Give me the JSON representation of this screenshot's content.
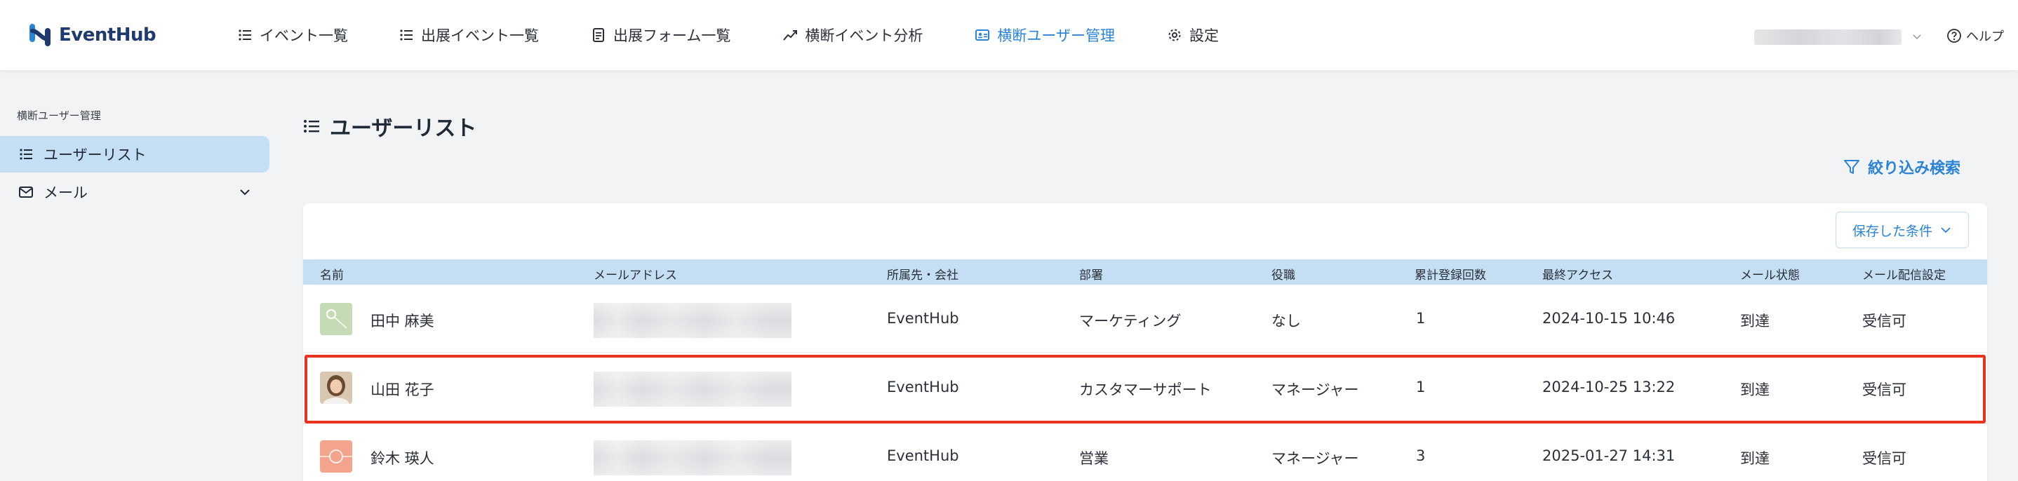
{
  "app": {
    "logo_text": "EventHub"
  },
  "nav": {
    "items": [
      {
        "label": "イベント一覧",
        "icon": "list-icon",
        "active": false
      },
      {
        "label": "出展イベント一覧",
        "icon": "list-icon",
        "active": false
      },
      {
        "label": "出展フォーム一覧",
        "icon": "form-icon",
        "active": false
      },
      {
        "label": "横断イベント分析",
        "icon": "chart-icon",
        "active": false
      },
      {
        "label": "横断ユーザー管理",
        "icon": "id-card-icon",
        "active": true
      },
      {
        "label": "設定",
        "icon": "gear-icon",
        "active": false
      }
    ],
    "help_label": "ヘルプ"
  },
  "sidebar": {
    "heading": "横断ユーザー管理",
    "items": [
      {
        "label": "ユーザーリスト",
        "icon": "list-icon",
        "active": true
      },
      {
        "label": "メール",
        "icon": "mail-icon",
        "active": false
      }
    ]
  },
  "main": {
    "title": "ユーザーリスト",
    "filter_label": "絞り込み検索",
    "saved_conditions_label": "保存した条件"
  },
  "table": {
    "columns": [
      "名前",
      "メールアドレス",
      "所属先・会社",
      "部署",
      "役職",
      "累計登録回数",
      "最終アクセス",
      "メール状態",
      "メール配信設定"
    ],
    "rows": [
      {
        "name": "田中 麻美",
        "company": "EventHub",
        "department": "マーケティング",
        "title": "なし",
        "count": "1",
        "last_access": "2024-10-15 10:46",
        "mail_status": "到達",
        "mail_setting": "受信可"
      },
      {
        "name": "山田 花子",
        "company": "EventHub",
        "department": "カスタマーサポート",
        "title": "マネージャー",
        "count": "1",
        "last_access": "2024-10-25 13:22",
        "mail_status": "到達",
        "mail_setting": "受信可"
      },
      {
        "name": "鈴木 瑛人",
        "company": "EventHub",
        "department": "営業",
        "title": "マネージャー",
        "count": "3",
        "last_access": "2025-01-27 14:31",
        "mail_status": "到達",
        "mail_setting": "受信可"
      }
    ]
  },
  "colors": {
    "accent": "#2b83d6",
    "header_row": "#c4def3",
    "highlight": "#e8331e",
    "brand": "#1e3a6e"
  }
}
